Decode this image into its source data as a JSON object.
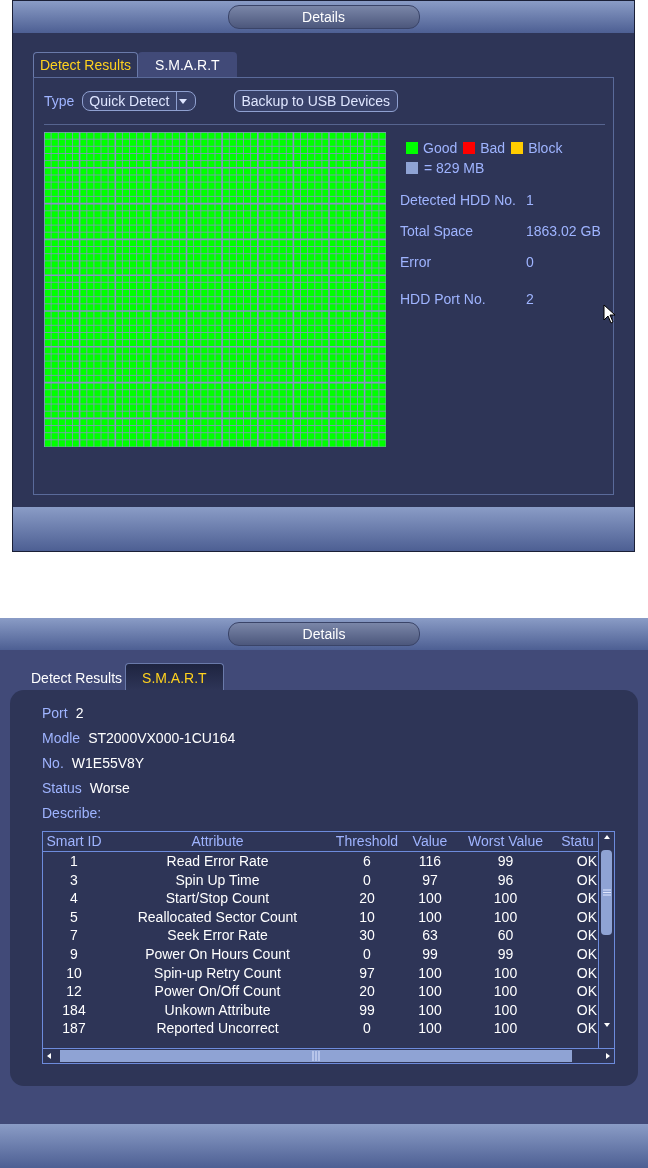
{
  "dialogs": [
    {
      "kind": "detect",
      "title": "Details",
      "tabs": [
        {
          "label": "Detect Results",
          "selected": true
        },
        {
          "label": "S.M.A.R.T",
          "selected": false
        }
      ],
      "type_label": "Type",
      "type_value": "Quick Detect",
      "backup_button": "Backup to USB Devices",
      "legend": [
        {
          "label": "Good",
          "color": "#00ff00"
        },
        {
          "label": "Bad",
          "color": "#ff0000"
        },
        {
          "label": "Block",
          "color": "#ffcc00"
        }
      ],
      "block_size": {
        "label": "= 829 MB",
        "color": "#8fa3d4"
      },
      "info": [
        {
          "label": "Detected HDD No.",
          "value": "1"
        },
        {
          "label": "Total Space",
          "value": "1863.02 GB"
        },
        {
          "label": "Error",
          "value": "0"
        },
        {
          "label": "HDD Port No.",
          "value": "2"
        }
      ]
    },
    {
      "kind": "smart",
      "title": "Details",
      "tabs": [
        {
          "label": "Detect Results",
          "selected": false
        },
        {
          "label": "S.M.A.R.T",
          "selected": true
        }
      ],
      "fields": [
        {
          "label": "Port",
          "value": "2"
        },
        {
          "label": "Modle",
          "value": "ST2000VX000-1CU164"
        },
        {
          "label": "No.",
          "value": "W1E55V8Y"
        },
        {
          "label": "Status",
          "value": "Worse"
        }
      ],
      "describe_label": "Describe:",
      "table": {
        "columns": [
          "Smart ID",
          "Attribute",
          "Threshold",
          "Value",
          "Worst Value",
          "Statu"
        ],
        "rows": [
          [
            "1",
            "Read Error Rate",
            "6",
            "116",
            "99",
            "OK"
          ],
          [
            "3",
            "Spin Up Time",
            "0",
            "97",
            "96",
            "OK"
          ],
          [
            "4",
            "Start/Stop Count",
            "20",
            "100",
            "100",
            "OK"
          ],
          [
            "5",
            "Reallocated Sector Count",
            "10",
            "100",
            "100",
            "OK"
          ],
          [
            "7",
            "Seek Error Rate",
            "30",
            "63",
            "60",
            "OK"
          ],
          [
            "9",
            "Power On Hours Count",
            "0",
            "99",
            "99",
            "OK"
          ],
          [
            "10",
            "Spin-up Retry Count",
            "97",
            "100",
            "100",
            "OK"
          ],
          [
            "12",
            "Power On/Off Count",
            "20",
            "100",
            "100",
            "OK"
          ],
          [
            "184",
            "Unkown Attribute",
            "99",
            "100",
            "100",
            "OK"
          ],
          [
            "187",
            "Reported Uncorrect",
            "0",
            "100",
            "100",
            "OK"
          ]
        ]
      }
    }
  ]
}
